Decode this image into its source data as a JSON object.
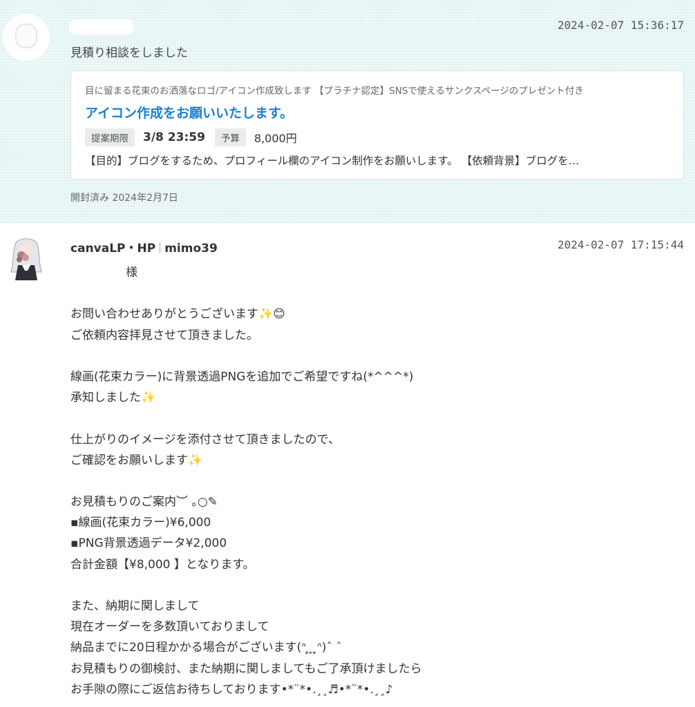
{
  "inquiry_message": {
    "timestamp": "2024-02-07 15:36:17",
    "summary": "見積り相談をしました",
    "card": {
      "service_name": "目に留まる花束のお洒落なロゴ/アイコン作成致します 【プラチナ認定】SNSで使えるサンクスページのプレゼント付き",
      "title": "アイコン作成をお願いいたします。",
      "deadline_label": "提案期限",
      "deadline_value": "3/8 23:59",
      "budget_label": "予算",
      "budget_value": "8,000円",
      "description": "【目的】ブログをするため、プロフィール欄のアイコン制作をお願いします。 【依頼背景】ブログを…"
    },
    "opened_status": "開封済み 2024年2月7日"
  },
  "reply_message": {
    "sender_name": "canvaLP・HP",
    "sender_id": "mimo39",
    "timestamp": "2024-02-07 17:15:44",
    "lines": [
      "様",
      "",
      "お問い合わせありがとうございます✨😊",
      "ご依頼内容拝見させて頂きました。",
      "",
      "線画(花束カラー)に背景透過PNGを追加でご希望ですね(*^^^*)",
      "承知しました✨",
      "",
      "仕上がりのイメージを添付させて頂きましたので、",
      "ご確認をお願いします✨",
      "",
      "お見積もりのご案内︶ ｡○✎",
      "▪線画(花束カラー)¥6,000",
      "▪PNG背景透過データ¥2,000",
      "合計金額【¥8,000 】となります。",
      "",
      "また、納期に関しまして",
      "現在オーダーを多数頂いておりまして",
      "納品までに20日程かかる場合がございます(ᐢ ̥ ̞ ̥ᐢ)ˆ ˆ",
      "お見積もりの御検討、また納期に関しましてもご了承頂けましたら",
      "お手隙の際にご返信お待ちしております•*¨*•.¸¸♬•*¨*•.¸¸♪"
    ]
  }
}
